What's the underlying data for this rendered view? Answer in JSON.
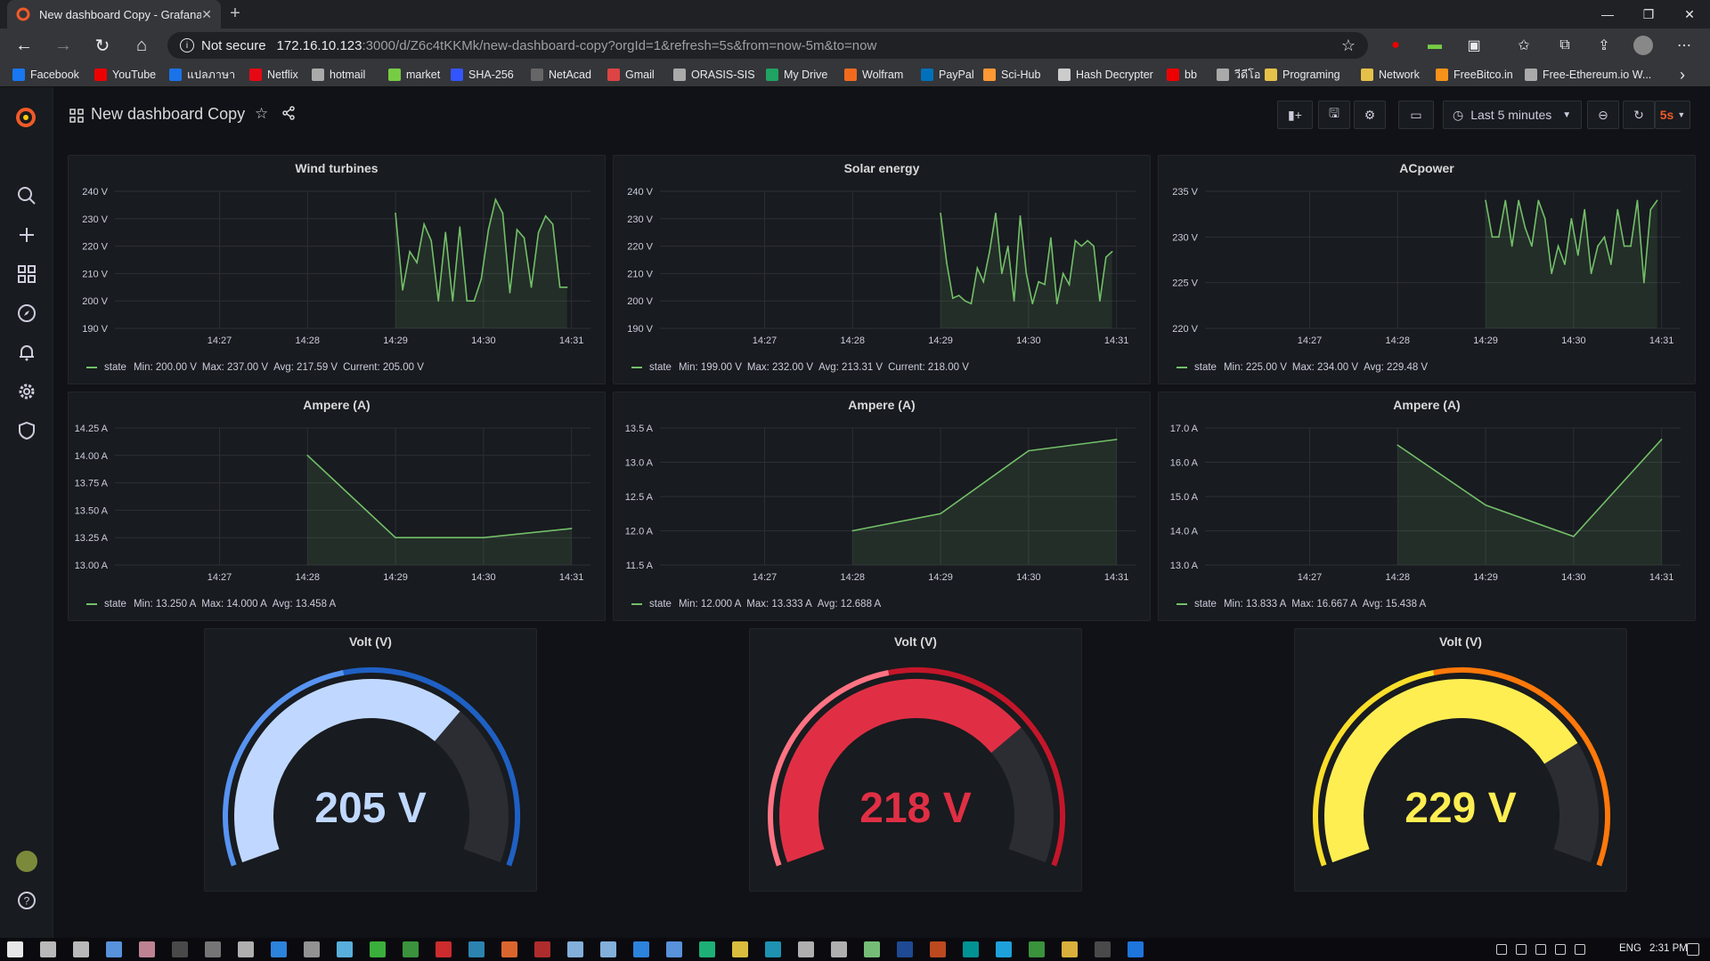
{
  "browser": {
    "tab_title": "New dashboard Copy - Grafana",
    "security": "Not secure",
    "url_host": "172.16.10.123",
    "url_path": ":3000/d/Z6c4tKKMk/new-dashboard-copy?orgId=1&refresh=5s&from=now-5m&to=now",
    "bookmarks": [
      "Facebook",
      "YouTube",
      "แปลภาษา",
      "Netflix",
      "hotmail",
      "market",
      "SHA-256",
      "NetAcad",
      "Gmail",
      "ORASIS-SIS",
      "My Drive",
      "Wolfram",
      "PayPal",
      "Sci-Hub",
      "Hash Decrypter",
      "bb",
      "วีดีโอ",
      "Programing",
      "Network",
      "FreeBitco.in",
      "Free-Ethereum.io W..."
    ]
  },
  "dashboard": {
    "title": "New dashboard Copy",
    "time_range": "Last 5 minutes",
    "refresh": "5s"
  },
  "panels": [
    {
      "title": "Wind turbines",
      "legend": {
        "name": "state",
        "min": "Min: 200.00 V",
        "max": "Max: 237.00 V",
        "avg": "Avg: 217.59 V",
        "current": "Current: 205.00 V"
      }
    },
    {
      "title": "Solar energy",
      "legend": {
        "name": "state",
        "min": "Min: 199.00 V",
        "max": "Max: 232.00 V",
        "avg": "Avg: 213.31 V",
        "current": "Current: 218.00 V"
      }
    },
    {
      "title": "ACpower",
      "legend": {
        "name": "state",
        "min": "Min: 225.00 V",
        "max": "Max: 234.00 V",
        "avg": "Avg: 229.48 V",
        "current": ""
      }
    },
    {
      "title": "Ampere (A)",
      "legend": {
        "name": "state",
        "min": "Min: 13.250 A",
        "max": "Max: 14.000 A",
        "avg": "Avg: 13.458 A",
        "current": ""
      }
    },
    {
      "title": "Ampere (A)",
      "legend": {
        "name": "state",
        "min": "Min: 12.000 A",
        "max": "Max: 13.333 A",
        "avg": "Avg: 12.688 A",
        "current": ""
      }
    },
    {
      "title": "Ampere (A)",
      "legend": {
        "name": "state",
        "min": "Min: 13.833 A",
        "max": "Max: 16.667 A",
        "avg": "Avg: 15.438 A",
        "current": ""
      }
    }
  ],
  "gauges": [
    {
      "title": "Volt (V)",
      "value": "205 V",
      "num": 205,
      "min": 0,
      "max": 300,
      "color": "#c0d8ff",
      "track": "#5794f2",
      "track2": "#1f60c4"
    },
    {
      "title": "Volt (V)",
      "value": "218 V",
      "num": 218,
      "min": 0,
      "max": 300,
      "color": "#e02f44",
      "track": "#ff7383",
      "track2": "#c4162a"
    },
    {
      "title": "Volt (V)",
      "value": "229 V",
      "num": 229,
      "min": 0,
      "max": 300,
      "color": "#ffee52",
      "track": "#fade2a",
      "track2": "#ff780a"
    }
  ],
  "chart_data": [
    {
      "type": "line",
      "title": "Wind turbines",
      "x": [
        "14:27",
        "14:28",
        "14:29",
        "14:30",
        "14:31"
      ],
      "yticks": [
        "240 V",
        "230 V",
        "220 V",
        "210 V",
        "200 V",
        "190 V"
      ],
      "ylim": [
        190,
        240
      ],
      "series": [
        {
          "name": "state",
          "x_start": 2.0,
          "x_end": 3.95,
          "values": [
            232,
            204,
            218,
            214,
            228,
            222,
            200,
            225,
            200,
            227,
            200,
            200,
            208,
            226,
            237,
            232,
            203,
            226,
            223,
            205,
            225,
            231,
            228,
            205,
            205
          ]
        }
      ]
    },
    {
      "type": "line",
      "title": "Solar energy",
      "x": [
        "14:27",
        "14:28",
        "14:29",
        "14:30",
        "14:31"
      ],
      "yticks": [
        "240 V",
        "230 V",
        "220 V",
        "210 V",
        "200 V",
        "190 V"
      ],
      "ylim": [
        190,
        240
      ],
      "series": [
        {
          "name": "state",
          "x_start": 2.0,
          "x_end": 3.95,
          "values": [
            232,
            214,
            201,
            202,
            200,
            199,
            212,
            207,
            218,
            232,
            210,
            220,
            200,
            231,
            210,
            199,
            207,
            206,
            223,
            199,
            210,
            206,
            222,
            220,
            222,
            220,
            200,
            216,
            218
          ]
        }
      ]
    },
    {
      "type": "line",
      "title": "ACpower",
      "x": [
        "14:27",
        "14:28",
        "14:29",
        "14:30",
        "14:31"
      ],
      "yticks": [
        "235 V",
        "230 V",
        "225 V",
        "220 V"
      ],
      "ylim": [
        220,
        235
      ],
      "series": [
        {
          "name": "state",
          "x_start": 2.0,
          "x_end": 3.95,
          "values": [
            234,
            230,
            230,
            234,
            229,
            234,
            231,
            229,
            234,
            232,
            226,
            229,
            227,
            232,
            228,
            233,
            226,
            229,
            230,
            227,
            233,
            229,
            229,
            234,
            225,
            233,
            234
          ]
        }
      ]
    },
    {
      "type": "line",
      "title": "Ampere (A)",
      "x": [
        "14:27",
        "14:28",
        "14:29",
        "14:30",
        "14:31"
      ],
      "yticks": [
        "14.25 A",
        "14.00 A",
        "13.75 A",
        "13.50 A",
        "13.25 A",
        "13.00 A"
      ],
      "ylim": [
        13.0,
        14.25
      ],
      "series": [
        {
          "name": "state",
          "points": [
            [
              1,
              14.0
            ],
            [
              2,
              13.25
            ],
            [
              3,
              13.25
            ],
            [
              4,
              13.333
            ]
          ]
        }
      ]
    },
    {
      "type": "line",
      "title": "Ampere (A)",
      "x": [
        "14:27",
        "14:28",
        "14:29",
        "14:30",
        "14:31"
      ],
      "yticks": [
        "13.5 A",
        "13.0 A",
        "12.5 A",
        "12.0 A",
        "11.5 A"
      ],
      "ylim": [
        11.5,
        13.5
      ],
      "series": [
        {
          "name": "state",
          "points": [
            [
              1,
              12.0
            ],
            [
              2,
              12.25
            ],
            [
              3,
              13.167
            ],
            [
              4,
              13.333
            ]
          ]
        }
      ]
    },
    {
      "type": "line",
      "title": "Ampere (A)",
      "x": [
        "14:27",
        "14:28",
        "14:29",
        "14:30",
        "14:31"
      ],
      "yticks": [
        "17.0 A",
        "16.0 A",
        "15.0 A",
        "14.0 A",
        "13.0 A"
      ],
      "ylim": [
        13.0,
        17.0
      ],
      "series": [
        {
          "name": "state",
          "points": [
            [
              1,
              16.5
            ],
            [
              2,
              14.75
            ],
            [
              3,
              13.833
            ],
            [
              4,
              16.667
            ]
          ]
        }
      ]
    }
  ],
  "taskbar": {
    "lang": "ENG",
    "time": "2:31 PM"
  },
  "colors": {
    "series": "#73bf69",
    "bg": "#111217",
    "panel": "#181b1f",
    "accent": "#f05a28"
  }
}
